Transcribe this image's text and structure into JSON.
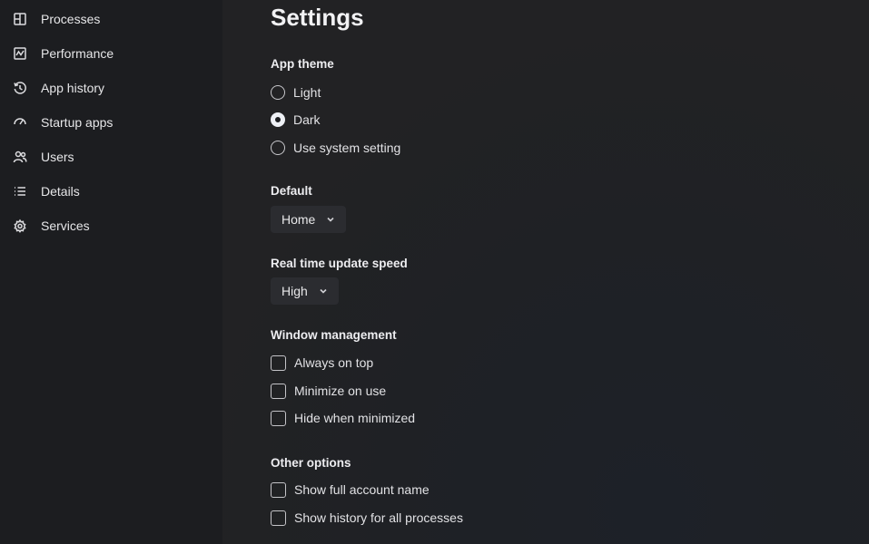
{
  "sidebar": {
    "items": [
      {
        "label": "Processes",
        "icon": "processes-icon"
      },
      {
        "label": "Performance",
        "icon": "performance-icon"
      },
      {
        "label": "App history",
        "icon": "app-history-icon"
      },
      {
        "label": "Startup apps",
        "icon": "startup-apps-icon"
      },
      {
        "label": "Users",
        "icon": "users-icon"
      },
      {
        "label": "Details",
        "icon": "details-icon"
      },
      {
        "label": "Services",
        "icon": "services-icon"
      }
    ]
  },
  "settings": {
    "title": "Settings",
    "app_theme": {
      "heading": "App theme",
      "options": [
        {
          "label": "Light",
          "selected": false
        },
        {
          "label": "Dark",
          "selected": true
        },
        {
          "label": "Use system setting",
          "selected": false
        }
      ]
    },
    "default": {
      "heading": "Default",
      "value": "Home"
    },
    "update_speed": {
      "heading": "Real time update speed",
      "value": "High"
    },
    "window_management": {
      "heading": "Window management",
      "options": [
        {
          "label": "Always on top",
          "checked": false
        },
        {
          "label": "Minimize on use",
          "checked": false
        },
        {
          "label": "Hide when minimized",
          "checked": false
        }
      ]
    },
    "other_options": {
      "heading": "Other options",
      "options": [
        {
          "label": "Show full account name",
          "checked": false
        },
        {
          "label": "Show history for all processes",
          "checked": false
        }
      ]
    }
  },
  "colors": {
    "sidebar_bg": "#1c1d20",
    "main_bg": "#1f2125",
    "dropdown_bg": "#2b2c30",
    "text": "#e8e8ea"
  }
}
